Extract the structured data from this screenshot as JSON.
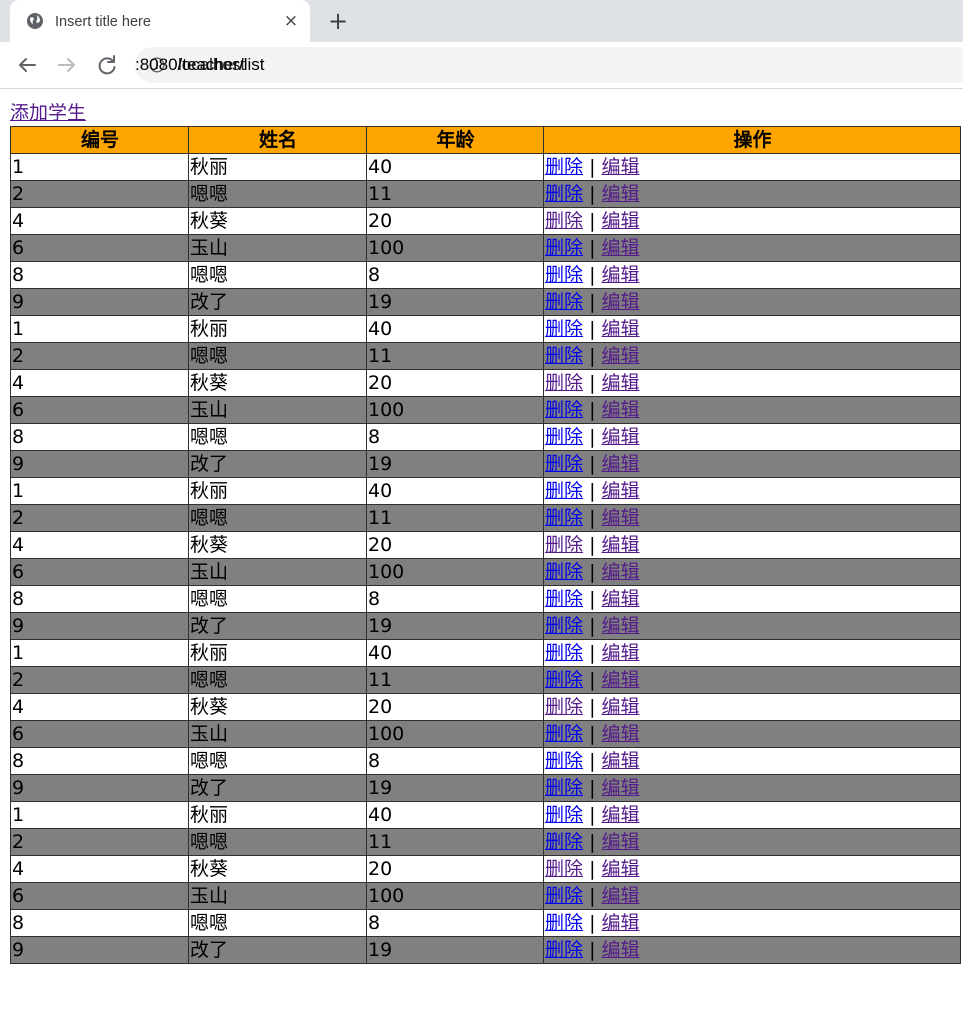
{
  "browser": {
    "tab_title": "Insert title here",
    "close_icon": "×",
    "new_tab_icon": "+",
    "url_host": "localhost",
    "url_path": ":8080/teacher/list",
    "accent_colors": {
      "tabstrip": "#dee1e6",
      "omnibox": "#f1f3f4"
    }
  },
  "page": {
    "add_link": "添加学生",
    "columns": [
      "编号",
      "姓名",
      "年龄",
      "操作"
    ],
    "delete_label": "删除",
    "separator": "|",
    "edit_label": "编辑",
    "header_color": "#ffa500",
    "stripe_color": "#808080",
    "rows": [
      {
        "id": "1",
        "name": "秋丽",
        "age": "40"
      },
      {
        "id": "2",
        "name": "嗯嗯",
        "age": "11"
      },
      {
        "id": "4",
        "name": "秋葵",
        "age": "20"
      },
      {
        "id": "6",
        "name": "玉山",
        "age": "100"
      },
      {
        "id": "8",
        "name": "嗯嗯",
        "age": "8"
      },
      {
        "id": "9",
        "name": "改了",
        "age": "19"
      },
      {
        "id": "1",
        "name": "秋丽",
        "age": "40"
      },
      {
        "id": "2",
        "name": "嗯嗯",
        "age": "11"
      },
      {
        "id": "4",
        "name": "秋葵",
        "age": "20"
      },
      {
        "id": "6",
        "name": "玉山",
        "age": "100"
      },
      {
        "id": "8",
        "name": "嗯嗯",
        "age": "8"
      },
      {
        "id": "9",
        "name": "改了",
        "age": "19"
      },
      {
        "id": "1",
        "name": "秋丽",
        "age": "40"
      },
      {
        "id": "2",
        "name": "嗯嗯",
        "age": "11"
      },
      {
        "id": "4",
        "name": "秋葵",
        "age": "20"
      },
      {
        "id": "6",
        "name": "玉山",
        "age": "100"
      },
      {
        "id": "8",
        "name": "嗯嗯",
        "age": "8"
      },
      {
        "id": "9",
        "name": "改了",
        "age": "19"
      },
      {
        "id": "1",
        "name": "秋丽",
        "age": "40"
      },
      {
        "id": "2",
        "name": "嗯嗯",
        "age": "11"
      },
      {
        "id": "4",
        "name": "秋葵",
        "age": "20"
      },
      {
        "id": "6",
        "name": "玉山",
        "age": "100"
      },
      {
        "id": "8",
        "name": "嗯嗯",
        "age": "8"
      },
      {
        "id": "9",
        "name": "改了",
        "age": "19"
      },
      {
        "id": "1",
        "name": "秋丽",
        "age": "40"
      },
      {
        "id": "2",
        "name": "嗯嗯",
        "age": "11"
      },
      {
        "id": "4",
        "name": "秋葵",
        "age": "20"
      },
      {
        "id": "6",
        "name": "玉山",
        "age": "100"
      },
      {
        "id": "8",
        "name": "嗯嗯",
        "age": "8"
      },
      {
        "id": "9",
        "name": "改了",
        "age": "19"
      }
    ]
  }
}
